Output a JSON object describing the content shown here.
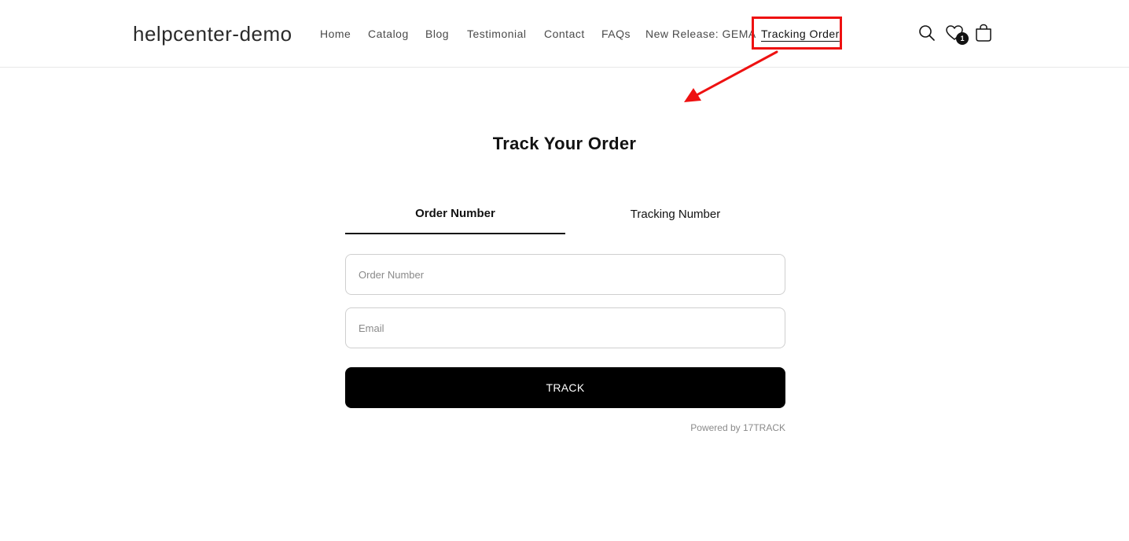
{
  "header": {
    "logo": "helpcenter-demo",
    "nav": [
      {
        "label": "Home"
      },
      {
        "label": "Catalog"
      },
      {
        "label": "Blog"
      },
      {
        "label": "Testimonial"
      },
      {
        "label": "Contact"
      },
      {
        "label": "FAQs"
      },
      {
        "label": "New Release: GEMA"
      },
      {
        "label": "Tracking Order"
      }
    ],
    "active_nav": "Tracking Order",
    "wishlist_count": "1",
    "icons": [
      "search-icon",
      "heart-icon",
      "cart-icon"
    ]
  },
  "annotation": {
    "highlight_color": "#ee1111"
  },
  "main": {
    "title": "Track Your Order",
    "tabs": [
      {
        "label": "Order Number",
        "active": true
      },
      {
        "label": "Tracking Number",
        "active": false
      }
    ],
    "order_number_placeholder": "Order Number",
    "email_placeholder": "Email",
    "track_button": "TRACK",
    "powered_by": "Powered by 17TRACK"
  },
  "colors": {
    "button": "#000000",
    "text": "#121212",
    "muted": "#8a8a8a"
  }
}
